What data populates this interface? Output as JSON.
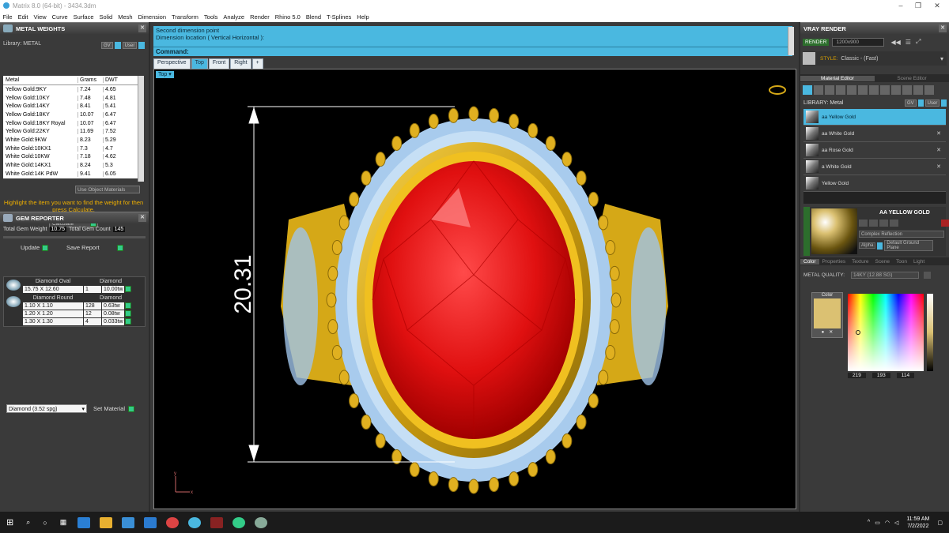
{
  "window": {
    "title": "Matrix 8.0 (64-bit) - 3434.3dm",
    "minimize": "–",
    "maximize": "❐",
    "close": "✕"
  },
  "menu": [
    "File",
    "Edit",
    "View",
    "Curve",
    "Surface",
    "Solid",
    "Mesh",
    "Dimension",
    "Transform",
    "Tools",
    "Analyze",
    "Render",
    "Rhino 5.0",
    "Blend",
    "T-Splines",
    "Help"
  ],
  "metal_weights": {
    "title": "METAL WEIGHTS",
    "library_label": "Library: METAL",
    "gv_label": "GV",
    "user_label": "User",
    "headers": [
      "Metal",
      "Grams",
      "DWT"
    ],
    "rows": [
      [
        "Yellow Gold:9KY",
        "7.24",
        "4.65"
      ],
      [
        "Yellow Gold:10KY",
        "7.48",
        "4.81"
      ],
      [
        "Yellow Gold:14KY",
        "8.41",
        "5.41"
      ],
      [
        "Yellow Gold:18KY",
        "10.07",
        "6.47"
      ],
      [
        "Yellow Gold:18KY Royal",
        "10.07",
        "6.47"
      ],
      [
        "Yellow Gold:22KY",
        "11.69",
        "7.52"
      ],
      [
        "White Gold:9KW",
        "8.23",
        "5.29"
      ],
      [
        "White Gold:10KX1",
        "7.3",
        "4.7"
      ],
      [
        "White Gold:10KW",
        "7.18",
        "4.62"
      ],
      [
        "White Gold:14KX1",
        "8.24",
        "5.3"
      ],
      [
        "White Gold:14K PdW",
        "9.41",
        "6.05"
      ]
    ],
    "use_object_materials": "Use Object Materials",
    "hint": "Highlight the item you want to find the weight for then press Calculate.",
    "calculate": "Calculate"
  },
  "gem_reporter": {
    "title": "GEM REPORTER",
    "total_weight_label": "Total Gem Weight",
    "total_weight": "10.75",
    "total_count_label": "Total Gem Count",
    "total_count": "145",
    "update": "Update",
    "save_report": "Save Report",
    "groups": [
      {
        "shape": "Diamond Oval",
        "type": "Diamond",
        "rows": [
          [
            "15.75 X 12.60",
            "1",
            "10.00tw"
          ]
        ]
      },
      {
        "shape": "Diamond Round",
        "type": "Diamond",
        "rows": [
          [
            "1.10 X 1.10",
            "128",
            "0.63tw"
          ],
          [
            "1.20 X 1.20",
            "12",
            "0.08tw"
          ],
          [
            "1.30 X 1.30",
            "4",
            "0.033tw"
          ]
        ]
      }
    ],
    "material_select": "Diamond    (3.52 spg)",
    "set_material": "Set Material"
  },
  "command": {
    "line1": "Second dimension point",
    "line2": "Dimension location ( Vertical  Horizontal ):",
    "prompt": "Command:"
  },
  "viewport": {
    "tabs": [
      "Perspective",
      "Top",
      "Front",
      "Right",
      "+"
    ],
    "active_tab": "Top",
    "label": "Top ▾",
    "dimension": "20.31",
    "axis_y": "y",
    "axis_x": "x"
  },
  "vray": {
    "title": "VRAY RENDER",
    "render": "RENDER",
    "resolution": "1200x900",
    "style_label": "STYLE:",
    "style_value": "Classic - (Fast)",
    "tab_material": "Material Editor",
    "tab_scene": "Scene Editor",
    "library_label": "LIBRARY: Metal",
    "gv_label": "GV",
    "user_label": "User",
    "materials": [
      "aa Yellow Gold",
      "aa White Gold",
      "aa Rose Gold",
      "a White Gold",
      "Yellow Gold"
    ],
    "preview_title": "AA YELLOW GOLD",
    "reflection": "Complex Reflection",
    "alpha": "Alpha",
    "ground": "Default Ground Plane",
    "subtabs": [
      "Color",
      "Properties",
      "Texture",
      "Scene",
      "Toon",
      "Light"
    ],
    "metal_quality_label": "METAL QUALITY:",
    "metal_quality": "14KY        (12.88 SG)",
    "color_label": "Color",
    "rgb": [
      "219",
      "193",
      "114"
    ],
    "swatch": "#dbc172"
  },
  "taskbar": {
    "time": "11:59 AM",
    "date": "7/2/2022"
  }
}
